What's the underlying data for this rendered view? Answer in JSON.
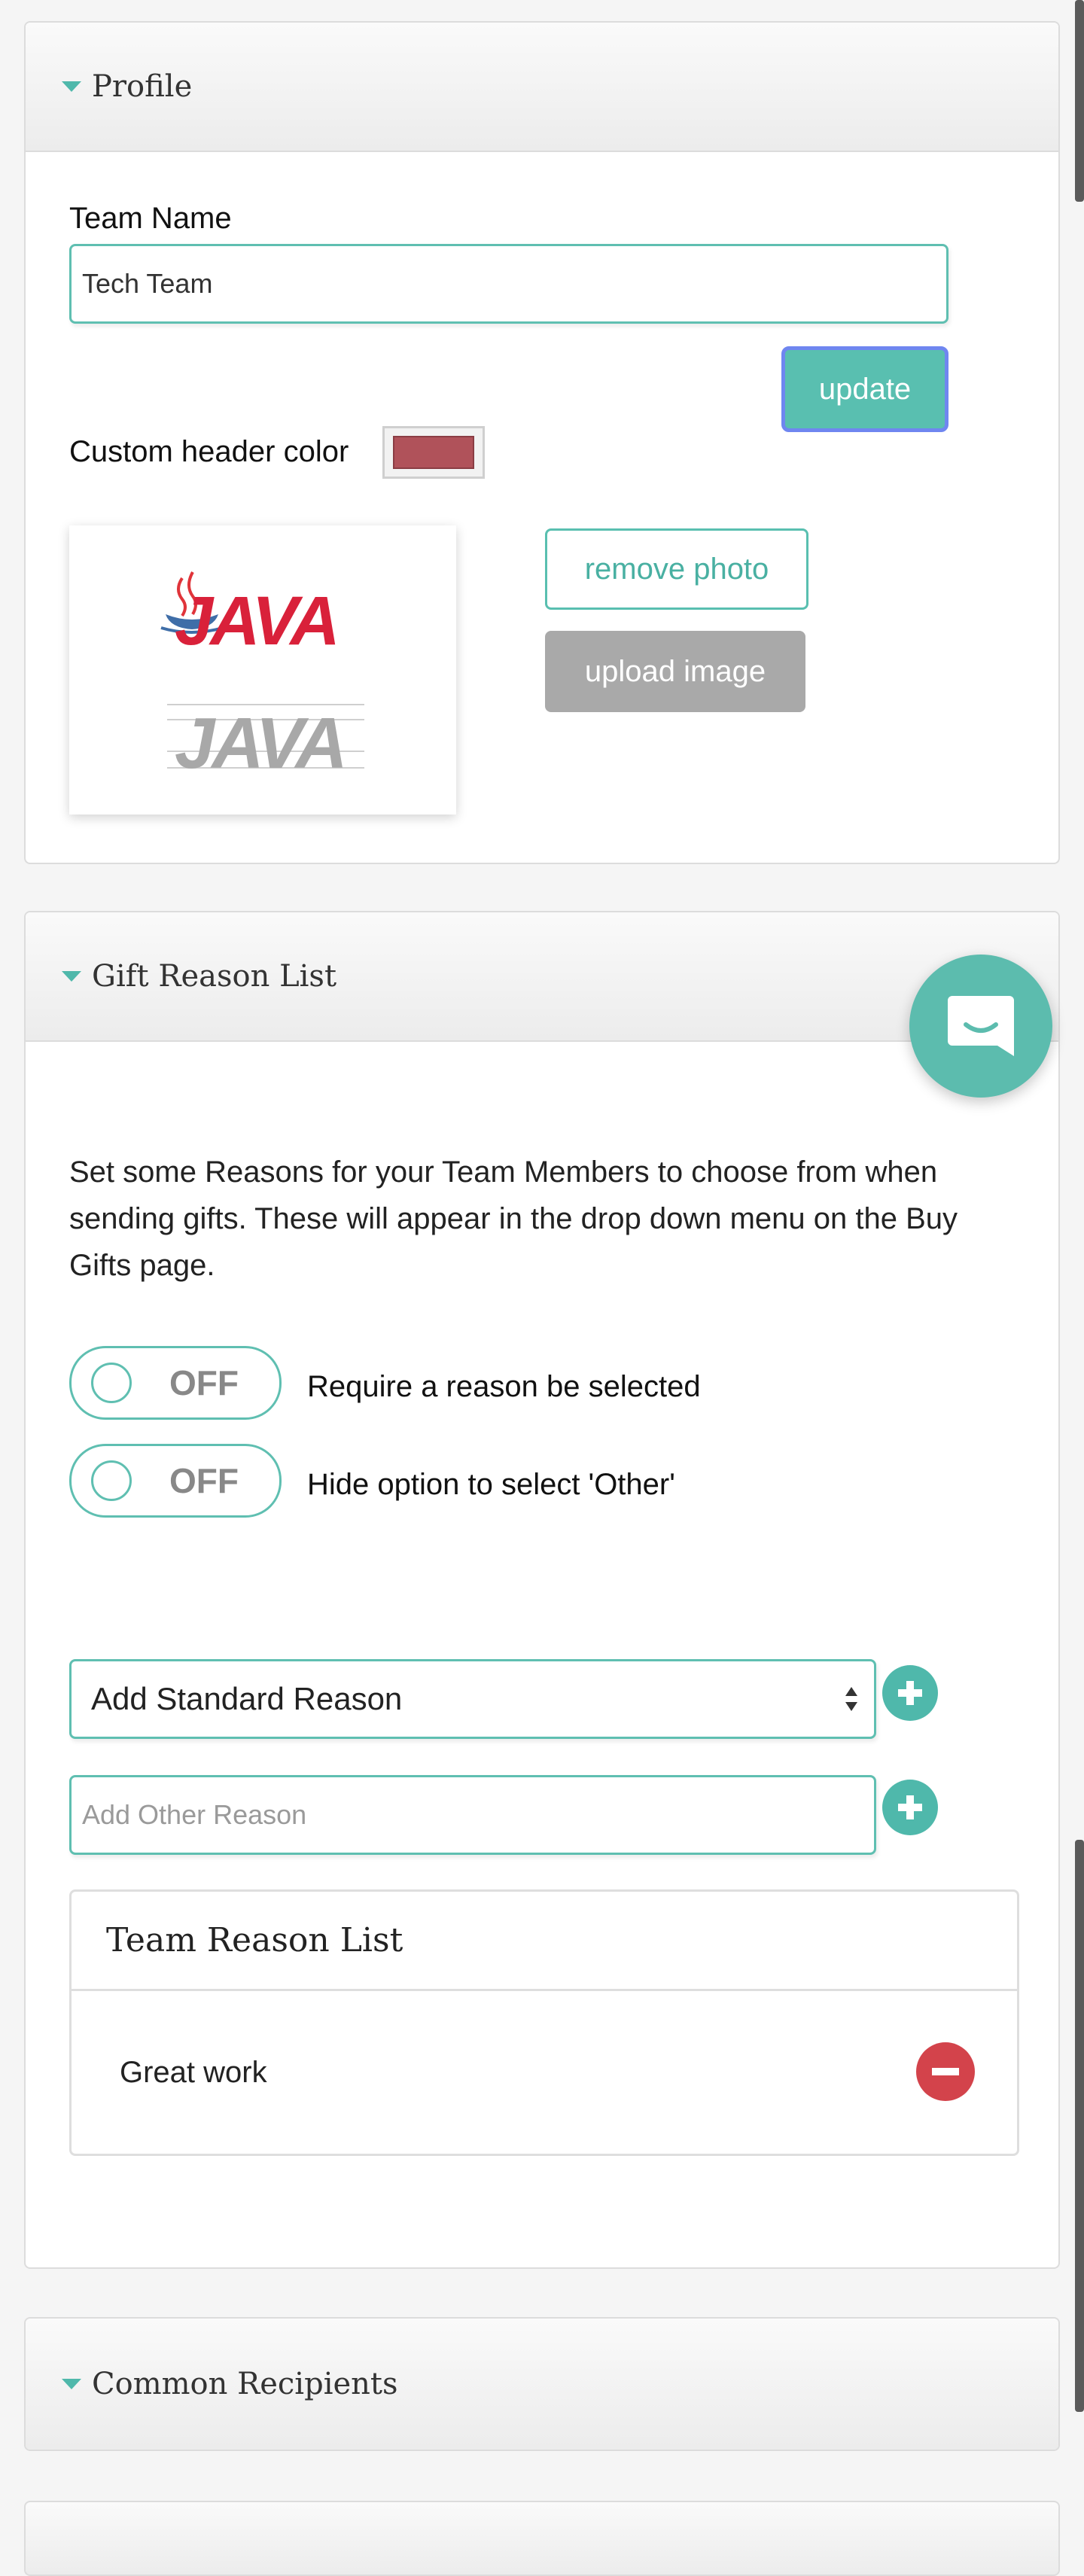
{
  "profile": {
    "section_title": "Profile",
    "team_name_label": "Team Name",
    "team_name_value": "Tech Team",
    "update_label": "update",
    "custom_header_color_label": "Custom header color",
    "custom_header_color": "#b0525a",
    "remove_photo_label": "remove photo",
    "upload_image_label": "upload image",
    "logo_text": "JAVA"
  },
  "gift_reasons": {
    "section_title": "Gift Reason List",
    "description": "Set some Reasons for your Team Members to choose from when sending gifts. These will appear in the drop down menu on the Buy Gifts page.",
    "toggles": [
      {
        "state": "OFF",
        "label": "Require a reason be selected"
      },
      {
        "state": "OFF",
        "label": "Hide option to select 'Other'"
      }
    ],
    "standard_reason_select": "Add Standard Reason",
    "other_reason_placeholder": "Add Other Reason",
    "team_reason_list_title": "Team Reason List",
    "reasons": [
      {
        "label": "Great work"
      }
    ]
  },
  "common_recipients": {
    "section_title": "Common Recipients"
  },
  "icons": {
    "caret": "caret-down-icon",
    "add": "plus-circle-icon",
    "remove": "minus-circle-icon",
    "chat": "chat-icon"
  },
  "colors": {
    "accent": "#59bfb0",
    "danger": "#d3434b",
    "update_focus_border": "#6f86f0"
  }
}
